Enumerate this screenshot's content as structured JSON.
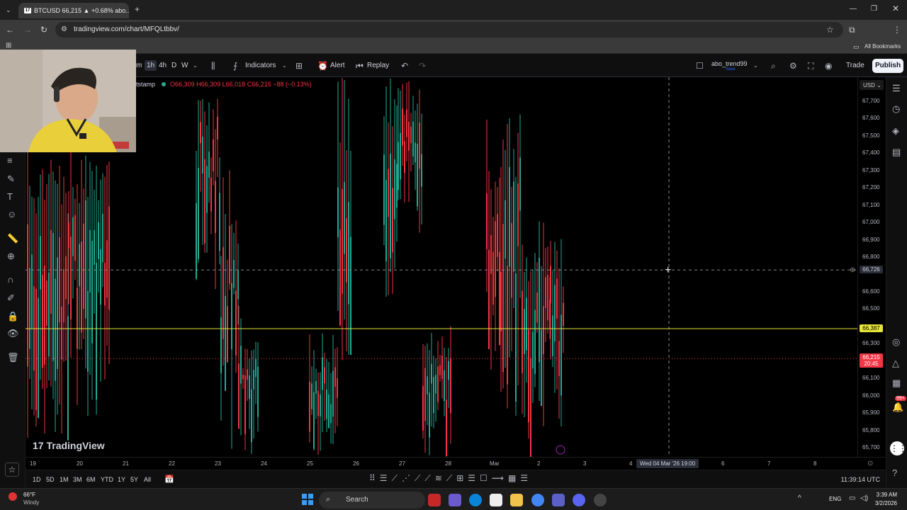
{
  "browser": {
    "tab_title": "BTCUSD 66,215 ▲ +0.68% abo...",
    "url": "tradingview.com/chart/MFQLtbbv/",
    "bookmarks_label": "All Bookmarks"
  },
  "toolbar": {
    "intervals": [
      "m",
      "1h",
      "4h",
      "D",
      "W"
    ],
    "active_interval": "1h",
    "indicators_label": "Indicators",
    "alert_label": "Alert",
    "replay_label": "Replay",
    "layout_name": "abo_trend99",
    "layout_status": "Save",
    "trade_label": "Trade",
    "publish_label": "Publish"
  },
  "legend": {
    "symbol": "tstamp",
    "open": "O66,309",
    "high": "H66,309",
    "low": "L66,018",
    "close": "C66,215",
    "change": "−88 (−0.13%)"
  },
  "price_axis": {
    "currency": "USD",
    "labels": [
      "67,700",
      "67,600",
      "67,500",
      "67,400",
      "67,300",
      "67,200",
      "67,100",
      "67,000",
      "66,900",
      "66,800",
      "66,600",
      "66,500",
      "66,300",
      "66,100",
      "66,000",
      "65,900",
      "65,800",
      "65,700"
    ],
    "crosshair_price": "66,726",
    "line_price": "66,387",
    "current_price": "66,215",
    "countdown": "20:45"
  },
  "time_axis": {
    "labels": [
      "19",
      "20",
      "21",
      "22",
      "23",
      "24",
      "25",
      "26",
      "27",
      "28",
      "Mar",
      "2",
      "3",
      "4",
      "6",
      "7",
      "8"
    ],
    "crosshair_time": "Wed 04 Mar '26   19:00"
  },
  "bottom": {
    "ranges": [
      "1D",
      "5D",
      "1M",
      "3M",
      "6M",
      "YTD",
      "1Y",
      "5Y",
      "All"
    ],
    "clock": "11:39:14 UTC"
  },
  "branding": {
    "logo_text": "TradingView"
  },
  "taskbar": {
    "weather_temp": "66°F",
    "weather_desc": "Windy",
    "search_label": "Search",
    "lang": "ENG",
    "time": "3:39 AM",
    "date": "3/2/2026",
    "notification_badge": "99+"
  },
  "colors": {
    "up": "#22ab94",
    "down": "#f23645",
    "hline": "#e6e63a",
    "accent": "#2962ff"
  }
}
